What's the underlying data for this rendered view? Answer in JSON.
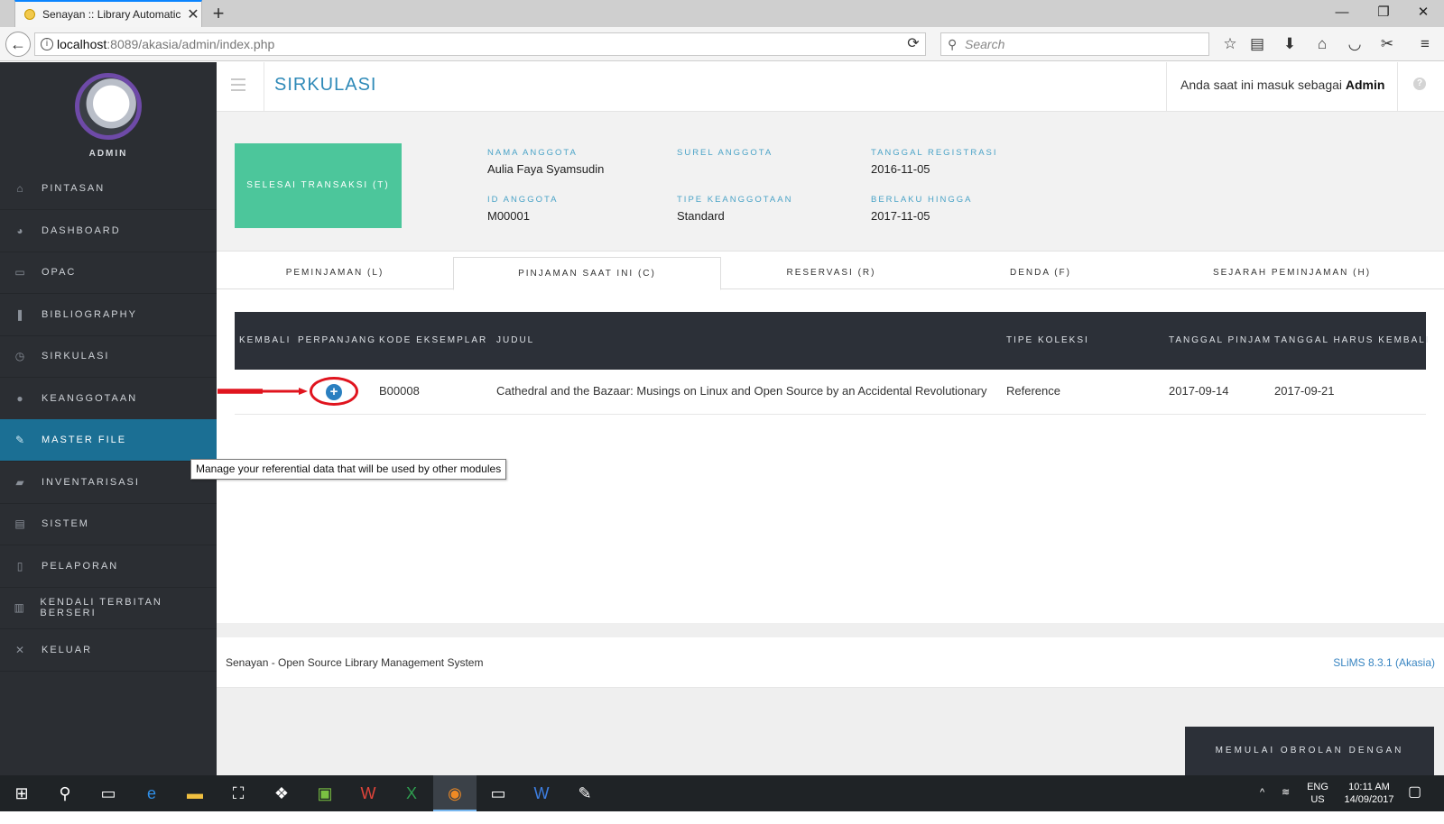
{
  "browser": {
    "tab_title": "Senayan :: Library Automatic",
    "url_host": "localhost",
    "url_rest": ":8089/akasia/admin/index.php",
    "search_placeholder": "Search"
  },
  "sidebar": {
    "user_label": "ADMIN",
    "items": [
      {
        "label": "PINTASAN",
        "icon": "home-icon"
      },
      {
        "label": "DASHBOARD",
        "icon": "dashboard-icon"
      },
      {
        "label": "OPAC",
        "icon": "monitor-icon"
      },
      {
        "label": "BIBLIOGRAPHY",
        "icon": "bookmark-icon"
      },
      {
        "label": "SIRKULASI",
        "icon": "clock-icon"
      },
      {
        "label": "KEANGGOTAAN",
        "icon": "user-icon"
      },
      {
        "label": "MASTER FILE",
        "icon": "pencil-icon"
      },
      {
        "label": "INVENTARISASI",
        "icon": "briefcase-icon"
      },
      {
        "label": "SISTEM",
        "icon": "keyboard-icon"
      },
      {
        "label": "PELAPORAN",
        "icon": "file-icon"
      },
      {
        "label": "KENDALI TERBITAN BERSERI",
        "icon": "barcode-icon"
      },
      {
        "label": "KELUAR",
        "icon": "close-icon"
      }
    ],
    "tooltip": "Manage your referential data that will be used by other modules"
  },
  "header": {
    "title": "SIRKULASI",
    "login_prefix": "Anda saat ini masuk sebagai",
    "login_user": "Admin"
  },
  "member": {
    "finish_button": "SELESAI TRANSAKSI (T)",
    "name_label": "NAMA ANGGOTA",
    "name": "Aulia Faya Syamsudin",
    "email_label": "SUREL ANGGOTA",
    "email": "",
    "reg_label": "TANGGAL REGISTRASI",
    "reg_date": "2016-11-05",
    "id_label": "ID ANGGOTA",
    "id": "M00001",
    "type_label": "TIPE KEANGGOTAAN",
    "type": "Standard",
    "valid_label": "BERLAKU HINGGA",
    "valid_until": "2017-11-05"
  },
  "tabs": [
    "PEMINJAMAN (L)",
    "PINJAMAN SAAT INI (C)",
    "RESERVASI (R)",
    "DENDA (F)",
    "SEJARAH PEMINJAMAN (H)"
  ],
  "table": {
    "headers": [
      "KEMBALI",
      "PERPANJANG",
      "KODE EKSEMPLAR",
      "JUDUL",
      "TIPE KOLEKSI",
      "TANGGAL PINJAM",
      "TANGGAL HARUS KEMBALI"
    ],
    "rows": [
      {
        "code": "B00008",
        "title": "Cathedral and the Bazaar: Musings on Linux and Open Source by an Accidental Revolutionary",
        "collection": "Reference",
        "loan_date": "2017-09-14",
        "due_date": "2017-09-21"
      }
    ]
  },
  "footer": {
    "left": "Senayan - Open Source Library Management System",
    "right": "SLiMS 8.3.1 (Akasia)",
    "chat_button": "MEMULAI OBROLAN DENGAN ANGGOTA"
  },
  "taskbar": {
    "lang": "ENG",
    "region": "US",
    "time": "10:11 AM",
    "date": "14/09/2017"
  },
  "colors": {
    "sidebar_bg": "#2b2e33",
    "active_menu": "#1b6f94",
    "accent_green": "#4cc69b",
    "title_blue": "#2f8ab8",
    "annotation_red": "#e0141e"
  }
}
